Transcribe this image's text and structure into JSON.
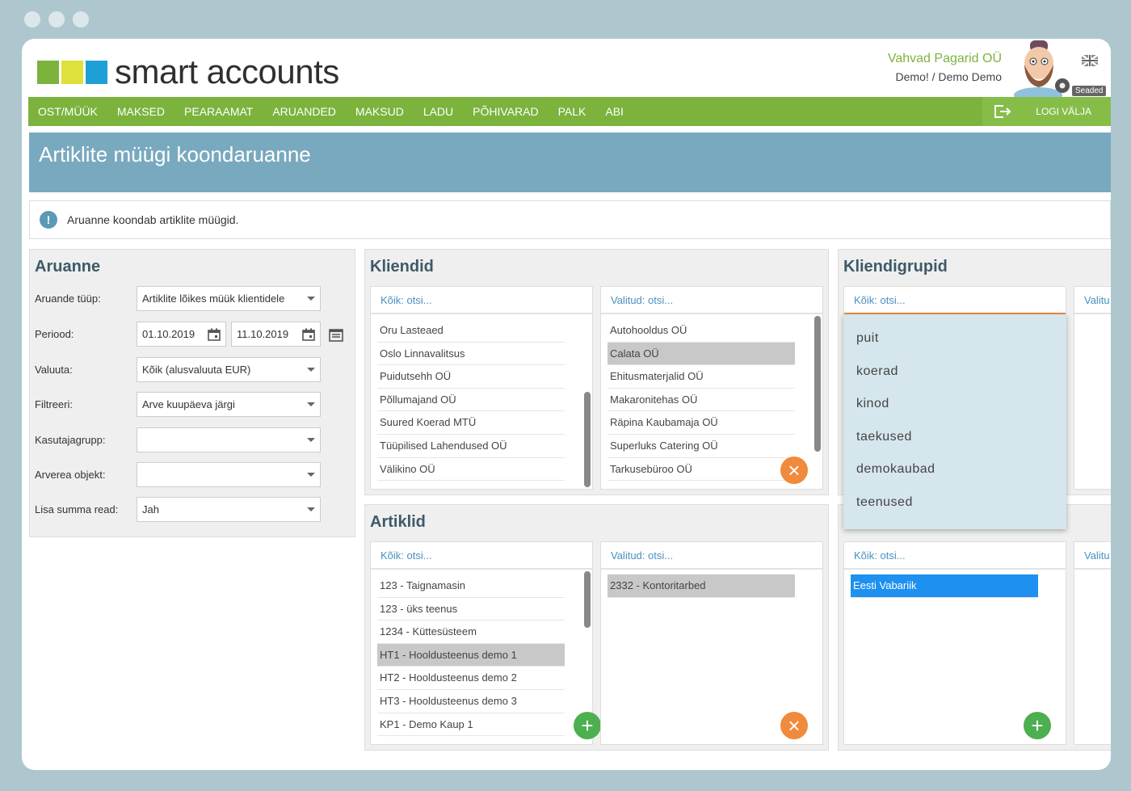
{
  "window_title": "smart accounts",
  "brand": {
    "name": "smart accounts",
    "colors": [
      "#7bb33d",
      "#dfe03a",
      "#1ea0d6"
    ]
  },
  "company": {
    "name": "Vahvad Pagarid OÜ",
    "user": "Demo! / Demo Demo",
    "settings_label": "Seaded",
    "language_icon": "uk-flag-icon"
  },
  "nav": {
    "items": [
      "OST/MÜÜK",
      "MAKSED",
      "PEARAAMAT",
      "ARUANDED",
      "MAKSUD",
      "LADU",
      "PÕHIVARAD",
      "PALK",
      "ABI"
    ],
    "logout": "LOGI VÄLJA"
  },
  "page_title": "Artiklite müügi koondaruanne",
  "info_text": "Aruanne koondab artiklite müügid.",
  "report": {
    "title": "Aruanne",
    "fields": [
      {
        "label": "Aruande tüüp:",
        "value": "Artiklite lõikes müük klientidele"
      },
      {
        "label": "Periood:",
        "from": "01.10.2019",
        "to": "11.10.2019"
      },
      {
        "label": "Valuuta:",
        "value": "Kõik (alusvaluuta EUR)"
      },
      {
        "label": "Filtreeri:",
        "value": "Arve kuupäeva järgi"
      },
      {
        "label": "Kasutajagrupp:",
        "value": ""
      },
      {
        "label": "Arverea objekt:",
        "value": ""
      },
      {
        "label": "Lisa summa read:",
        "value": "Jah"
      }
    ]
  },
  "clients": {
    "title": "Kliendid",
    "all_placeholder": "Kõik: otsi...",
    "selected_placeholder": "Valitud: otsi...",
    "all": [
      "Oru Lasteaed",
      "Oslo Linnavalitsus",
      "Puidutsehh OÜ",
      "Põllumajand OÜ",
      "Suured Koerad MTÜ",
      "Tüüpilised Lahendused OÜ",
      "Välikino OÜ"
    ],
    "selected": [
      "Autohooldus OÜ",
      "Calata OÜ",
      "Ehitusmaterjalid OÜ",
      "Makaronitehas OÜ",
      "Räpina Kaubamaja OÜ",
      "Superluks Catering OÜ",
      "Tarkusebüroo OÜ"
    ]
  },
  "client_groups": {
    "title": "Kliendigrupid",
    "all_placeholder": "Kõik: otsi...",
    "selected_placeholder": "Valitu",
    "dropdown": [
      "puit",
      "koerad",
      "kinod",
      "taekused",
      "demokaubad",
      "teenused"
    ]
  },
  "articles": {
    "title": "Artiklid",
    "all_placeholder": "Kõik: otsi...",
    "selected_placeholder": "Valitud: otsi...",
    "all": [
      "123 - Taignamasin",
      "123 - üks teenus",
      "1234 - Küttesüsteem",
      "HT1 - Hooldusteenus demo 1",
      "HT2 - Hooldusteenus demo 2",
      "HT3 - Hooldusteenus demo 3",
      "KP1 - Demo Kaup 1"
    ],
    "selected": [
      "2332 - Kontoritarbed"
    ]
  },
  "regions": {
    "all_placeholder": "Kõik: otsi...",
    "selected_placeholder": "Valitu",
    "all": [
      "Eesti Vabariik"
    ]
  }
}
